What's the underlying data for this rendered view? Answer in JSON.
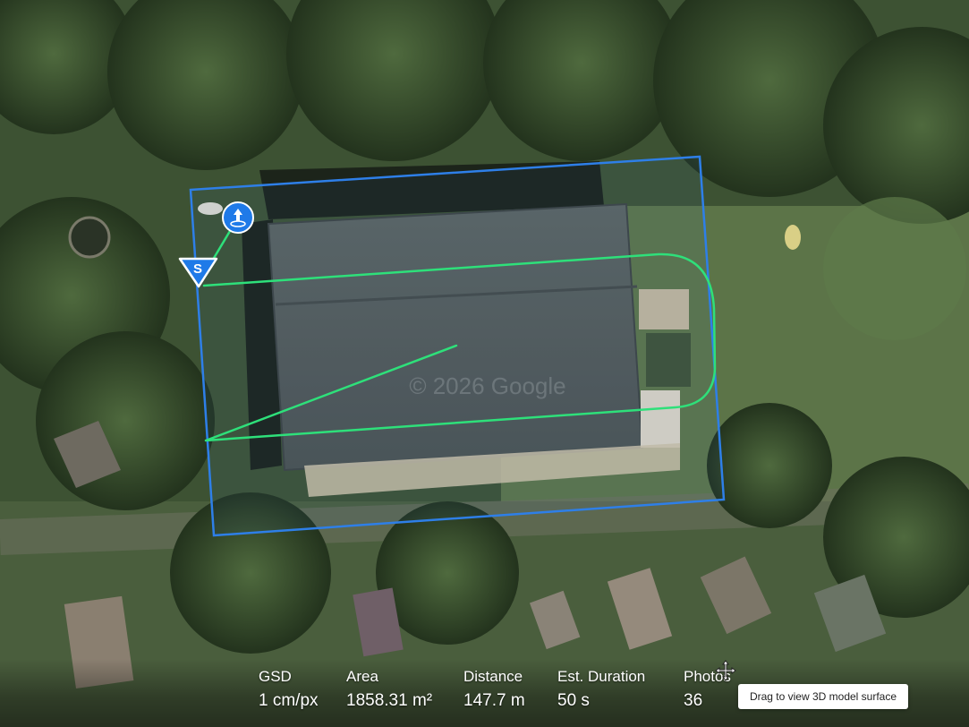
{
  "map": {
    "watermark": "© 2026 Google",
    "start_marker_label": "S"
  },
  "stats": {
    "gsd": {
      "label": "GSD",
      "value": "1 cm/px"
    },
    "area": {
      "label": "Area",
      "value": "1858.31 m²"
    },
    "distance": {
      "label": "Distance",
      "value": "147.7 m"
    },
    "duration": {
      "label": "Est. Duration",
      "value": "50 s"
    },
    "photos": {
      "label": "Photos",
      "value": "36"
    }
  },
  "tooltip": {
    "text": "Drag to view 3D model surface"
  },
  "colors": {
    "boundary": "#2e7fe8",
    "flight_path": "#2ee07a",
    "marker_blue": "#1f7ae8",
    "marker_white": "#ffffff"
  },
  "icons": {
    "takeoff": "takeoff-point-icon",
    "start": "start-point-icon",
    "move_cursor": "move-cursor-icon"
  }
}
